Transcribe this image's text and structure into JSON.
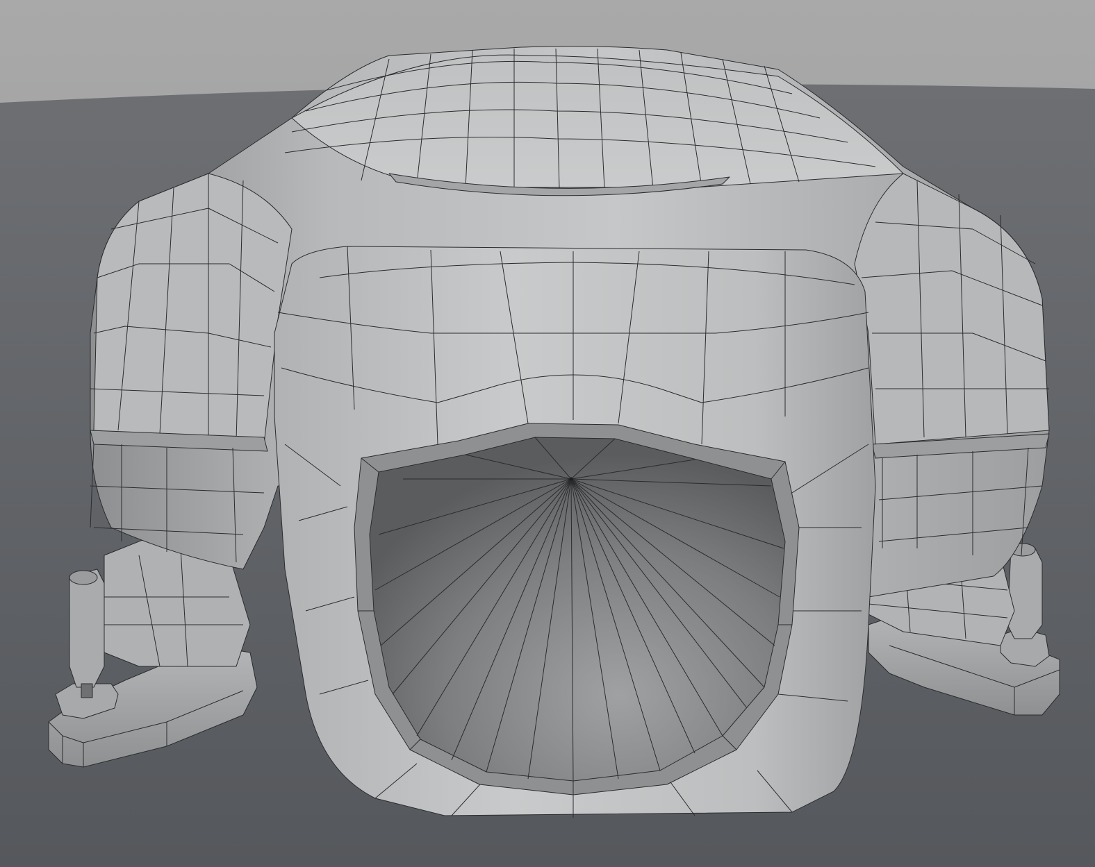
{
  "viewport": {
    "kind": "3d-modeling-viewport",
    "shading": "solid-gray-with-wireframe",
    "subject": "intake-manifold-mesh"
  },
  "colors": {
    "sky_top": "#a6a6a6",
    "sky_bottom": "#8f9092",
    "ground_far": "#6c6e72",
    "ground_near": "#55585c",
    "mesh_light": "#c9cbcc",
    "mesh_mid": "#a9abad",
    "mesh_dark": "#7f8184",
    "bore_dark": "#5e6062",
    "wire": "#2a2b2d"
  }
}
